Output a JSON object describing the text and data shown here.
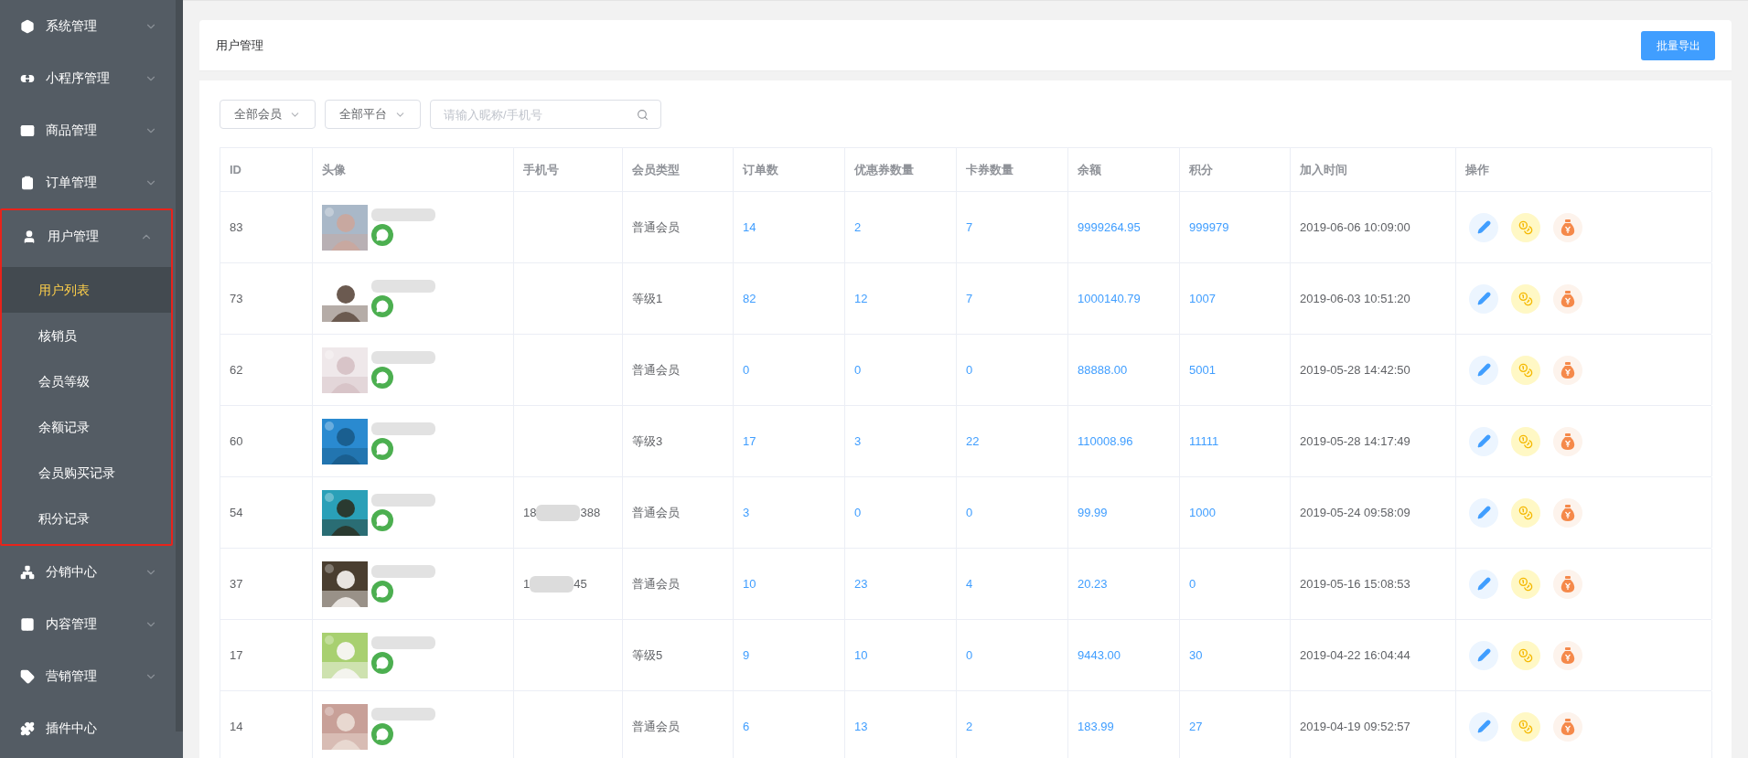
{
  "sidebar": {
    "items": [
      {
        "label": "系统管理",
        "kind": "menu",
        "expanded": false,
        "highlighted": false
      },
      {
        "label": "小程序管理",
        "kind": "menu",
        "expanded": false,
        "highlighted": false
      },
      {
        "label": "商品管理",
        "kind": "menu",
        "expanded": false,
        "highlighted": false
      },
      {
        "label": "订单管理",
        "kind": "menu",
        "expanded": false,
        "highlighted": false
      },
      {
        "label": "用户管理",
        "kind": "menu",
        "expanded": true,
        "highlighted": true,
        "children": [
          {
            "label": "用户列表",
            "selected": true
          },
          {
            "label": "核销员",
            "selected": false
          },
          {
            "label": "会员等级",
            "selected": false
          },
          {
            "label": "余额记录",
            "selected": false
          },
          {
            "label": "会员购买记录",
            "selected": false
          },
          {
            "label": "积分记录",
            "selected": false
          }
        ]
      },
      {
        "label": "分销中心",
        "kind": "menu",
        "expanded": false,
        "highlighted": false
      },
      {
        "label": "内容管理",
        "kind": "menu",
        "expanded": false,
        "highlighted": false
      },
      {
        "label": "营销管理",
        "kind": "menu",
        "expanded": false,
        "highlighted": false
      },
      {
        "label": "插件中心",
        "kind": "link",
        "expanded": false,
        "highlighted": false
      }
    ]
  },
  "header": {
    "title": "用户管理",
    "button": "批量导出"
  },
  "filters": {
    "selects": [
      "全部会员",
      "全部平台"
    ],
    "search": {
      "placeholder": "请输入昵称/手机号"
    }
  },
  "table": {
    "columns": [
      "ID",
      "头像",
      "手机号",
      "会员类型",
      "订单数",
      "优惠券数量",
      "卡券数量",
      "余额",
      "积分",
      "加入时间",
      "操作"
    ],
    "rows": [
      {
        "id": "83",
        "member_type": "普通会员",
        "orders": "14",
        "coupons": "2",
        "cards": "7",
        "balance": "9999264.95",
        "points": "999979",
        "joined": "2019-06-06 10:09:00"
      },
      {
        "id": "73",
        "member_type": "等级1",
        "orders": "82",
        "coupons": "12",
        "cards": "7",
        "balance": "1000140.79",
        "points": "1007",
        "joined": "2019-06-03 10:51:20"
      },
      {
        "id": "62",
        "member_type": "普通会员",
        "orders": "0",
        "coupons": "0",
        "cards": "0",
        "balance": "88888.00",
        "points": "5001",
        "joined": "2019-05-28 14:42:50"
      },
      {
        "id": "60",
        "member_type": "等级3",
        "orders": "17",
        "coupons": "3",
        "cards": "22",
        "balance": "110008.96",
        "points": "11111",
        "joined": "2019-05-28 14:17:49"
      },
      {
        "id": "54",
        "phone": [
          "18",
          "388"
        ],
        "member_type": "普通会员",
        "orders": "3",
        "coupons": "0",
        "cards": "0",
        "balance": "99.99",
        "points": "1000",
        "joined": "2019-05-24 09:58:09"
      },
      {
        "id": "37",
        "phone": [
          "1",
          "45"
        ],
        "member_type": "普通会员",
        "orders": "10",
        "coupons": "23",
        "cards": "4",
        "balance": "20.23",
        "points": "0",
        "joined": "2019-05-16 15:08:53"
      },
      {
        "id": "17",
        "member_type": "等级5",
        "orders": "9",
        "coupons": "10",
        "cards": "0",
        "balance": "9443.00",
        "points": "30",
        "joined": "2019-04-22 16:04:44"
      },
      {
        "id": "14",
        "member_type": "普通会员",
        "orders": "6",
        "coupons": "13",
        "cards": "2",
        "balance": "183.99",
        "points": "27",
        "joined": "2019-04-19 09:52:57"
      }
    ]
  }
}
